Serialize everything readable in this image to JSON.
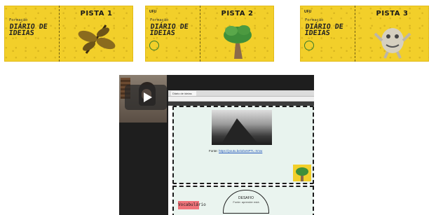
{
  "cards": [
    {
      "brand": "",
      "formacao": "Formação",
      "title": "DIÁRIO DE\nIDEIAS",
      "pista": "PISTA 1"
    },
    {
      "brand": "UFU",
      "formacao": "Formação",
      "title": "DIÁRIO DE\nIDEIAS",
      "pista": "PISTA 2"
    },
    {
      "brand": "UFU",
      "formacao": "Formação",
      "title": "DIÁRIO DE\nIDEIAS",
      "pista": "PISTA 3"
    }
  ],
  "browser": {
    "tab_label": "Diário de ideias",
    "fonte_label": "Fonte:",
    "fonte_link": "https://youtu.be/ahxNPTL-Xmw",
    "tag_label": "Vocabulário",
    "oval_title": "DESAFIO",
    "oval_text": "Fonte: aprender está"
  },
  "video": {
    "play_label": "play"
  },
  "colors": {
    "card_yellow": "#f2cf2a",
    "tag_pink": "#f0737a",
    "slide_bg": "#e8f3ee"
  }
}
